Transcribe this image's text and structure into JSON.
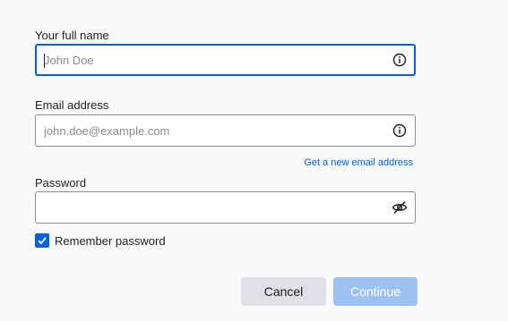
{
  "fullname": {
    "label": "Your full name",
    "placeholder": "John Doe",
    "value": "",
    "icon": "info-icon"
  },
  "email": {
    "label": "Email address",
    "placeholder": "john.doe@example.com",
    "value": "",
    "icon": "info-icon",
    "new_address_link": "Get a new email address"
  },
  "password": {
    "label": "Password",
    "value": "",
    "icon": "eye-slash-icon"
  },
  "remember": {
    "label": "Remember password",
    "checked": true
  },
  "buttons": {
    "cancel": "Cancel",
    "continue": "Continue",
    "continue_enabled": false
  },
  "colors": {
    "accent": "#0060df",
    "continue_disabled": "#9dc2f2",
    "cancel_bg": "#e0e0e6",
    "background": "#f9f9f9"
  }
}
